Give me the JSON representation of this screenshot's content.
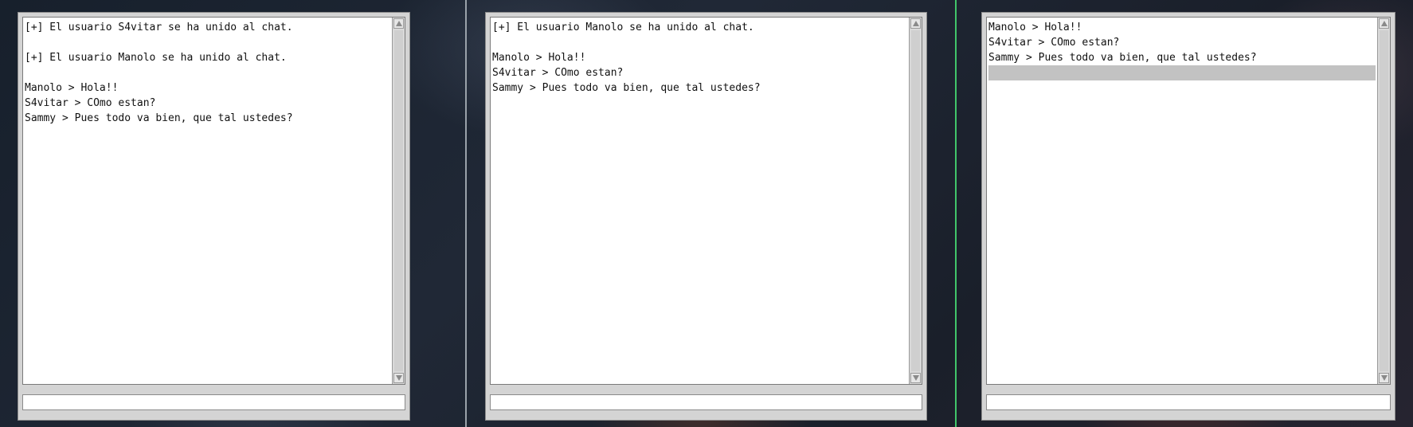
{
  "windows": [
    {
      "lines": [
        "[+] El usuario S4vitar se ha unido al chat.",
        "",
        "[+] El usuario Manolo se ha unido al chat.",
        "",
        "Manolo > Hola!!",
        "S4vitar > COmo estan?",
        "Sammy > Pues todo va bien, que tal ustedes?"
      ],
      "input_value": "",
      "input_placeholder": ""
    },
    {
      "lines": [
        "[+] El usuario Manolo se ha unido al chat.",
        "",
        "Manolo > Hola!!",
        "S4vitar > COmo estan?",
        "Sammy > Pues todo va bien, que tal ustedes?"
      ],
      "input_value": "",
      "input_placeholder": ""
    },
    {
      "lines": [
        "Manolo > Hola!!",
        "S4vitar > COmo estan?",
        "Sammy > Pues todo va bien, que tal ustedes?",
        ""
      ],
      "selected_line": 3,
      "input_value": "",
      "input_placeholder": ""
    }
  ],
  "icons": {
    "scroll_up": "scroll-up-arrow-icon",
    "scroll_down": "scroll-down-arrow-icon"
  },
  "colors": {
    "window_bg": "#d4d4d4",
    "log_bg": "#ffffff",
    "selection": "#c2c2c2",
    "divider_left": "#9aa2aa",
    "divider_right": "#41c66a"
  }
}
